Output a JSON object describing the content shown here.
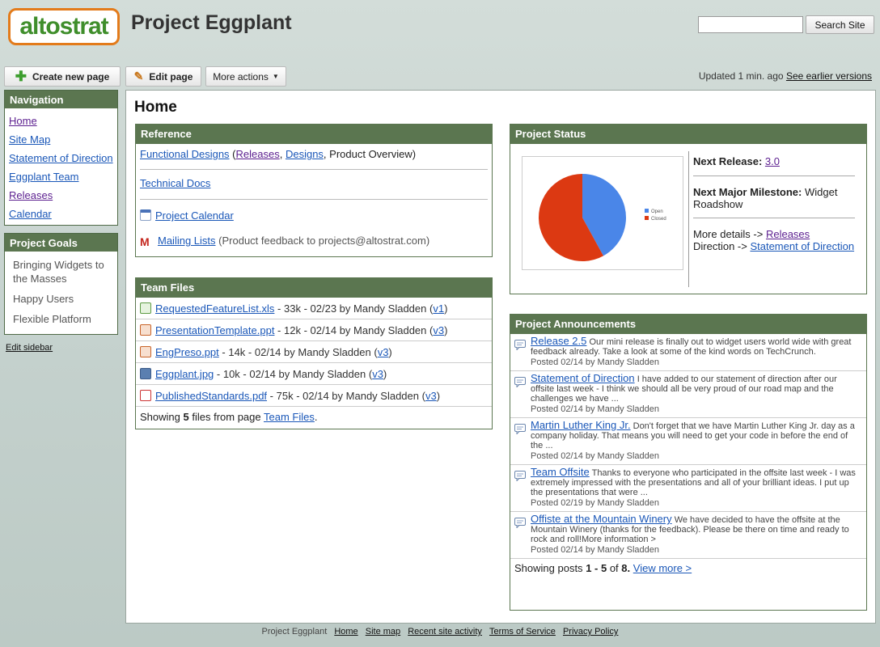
{
  "header": {
    "logo_text": "altostrat",
    "site_title": "Project Eggplant",
    "search_placeholder": "",
    "search_button": "Search Site"
  },
  "toolbar": {
    "create_label": "Create new page",
    "edit_label": "Edit page",
    "more_label": "More actions",
    "updated_text": "Updated 1 min. ago",
    "earlier_versions": "See earlier versions"
  },
  "sidebar": {
    "nav_title": "Navigation",
    "nav_items": [
      "Home",
      "Site Map",
      "Statement of Direction",
      "Eggplant Team",
      "Releases",
      "Calendar"
    ],
    "goals_title": "Project Goals",
    "goals": [
      "Bringing Widgets to the Masses",
      "Happy Users",
      "Flexible Platform"
    ],
    "edit_sidebar": "Edit sidebar"
  },
  "page": {
    "title": "Home"
  },
  "reference": {
    "title": "Reference",
    "functional_designs": "Functional Designs",
    "releases": "Releases",
    "designs": "Designs",
    "product_overview": "Product Overview",
    "technical_docs": "Technical Docs",
    "project_calendar": "Project Calendar",
    "mailing_lists": "Mailing Lists",
    "mailing_note": "(Product feedback to projects@altostrat.com)"
  },
  "team_files": {
    "title": "Team Files",
    "files": [
      {
        "name": "RequestedFeatureList.xls",
        "size": "33k",
        "date": "02/23",
        "author": "Mandy Sladden",
        "version": "v1",
        "icon": "spreadsheet-icon"
      },
      {
        "name": "PresentationTemplate.ppt",
        "size": "12k",
        "date": "02/14",
        "author": "Mandy Sladden",
        "version": "v3",
        "icon": "presentation-icon"
      },
      {
        "name": "EngPreso.ppt",
        "size": "14k",
        "date": "02/14",
        "author": "Mandy Sladden",
        "version": "v3",
        "icon": "presentation-icon"
      },
      {
        "name": "Eggplant.jpg",
        "size": "10k",
        "date": "02/14",
        "author": "Mandy Sladden",
        "version": "v3",
        "icon": "image-icon"
      },
      {
        "name": "PublishedStandards.pdf",
        "size": "75k",
        "date": "02/14",
        "author": "Mandy Sladden",
        "version": "v3",
        "icon": "pdf-icon"
      }
    ],
    "footer_prefix": "Showing",
    "footer_count": "5",
    "footer_mid": "files from page",
    "footer_link": "Team Files"
  },
  "project_status": {
    "title": "Project Status",
    "next_release_label": "Next Release:",
    "next_release_value": "3.0",
    "milestone_label": "Next Major Milestone:",
    "milestone_value": "Widget Roadshow",
    "more_details": "More details ->",
    "releases_link": "Releases",
    "direction": "Direction ->",
    "direction_link": "Statement of Direction"
  },
  "chart_data": {
    "type": "pie",
    "categories": [
      "Open",
      "Closed"
    ],
    "values": [
      42,
      58
    ],
    "colors": [
      "#4a86e8",
      "#dc3912"
    ],
    "legend": "right"
  },
  "announcements": {
    "title": "Project Announcements",
    "posts": [
      {
        "title": "Release 2.5",
        "excerpt": "Our mini release is finally out to widget users world wide with great feedback already. Take a look at some of the kind words on TechCrunch.",
        "posted": "Posted 02/14 by Mandy Sladden"
      },
      {
        "title": "Statement of Direction",
        "excerpt": "I have added to our statement of direction after our offsite last week - I think we should all be very proud of our road map and the challenges we have ...",
        "posted": "Posted 02/14 by Mandy Sladden"
      },
      {
        "title": "Martin Luther King Jr.",
        "excerpt": "Don't forget that we have Martin Luther King Jr. day as a company holiday. That means you will need to get your code in before the end of the ...",
        "posted": "Posted 02/14 by Mandy Sladden"
      },
      {
        "title": "Team Offsite",
        "excerpt": "Thanks to everyone who participated in the offsite last week - I was extremely impressed with the presentations and all of your brilliant ideas. I put up the presentations that were ...",
        "posted": "Posted 02/19 by Mandy Sladden"
      },
      {
        "title": "Offiste at the Mountain Winery",
        "excerpt": "We have decided to have the offsite at the Mountain Winery (thanks for the feedback). Please be there on time and ready to rock and roll!More information >",
        "posted": "Posted 02/14 by Mandy Sladden"
      }
    ],
    "footer_prefix": "Showing posts",
    "footer_range": "1 - 5",
    "footer_of": "of",
    "footer_total": "8.",
    "view_more": "View more >"
  },
  "footer": {
    "site": "Project Eggplant",
    "links": [
      "Home",
      "Site map",
      "Recent site activity",
      "Terms of Service",
      "Privacy Policy"
    ]
  }
}
